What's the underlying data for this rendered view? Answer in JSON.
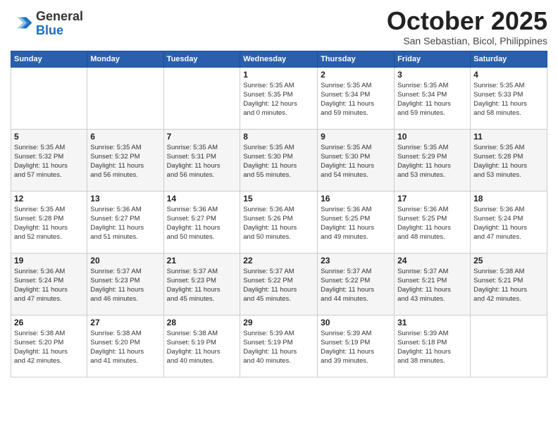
{
  "header": {
    "logo_line1": "General",
    "logo_line2": "Blue",
    "month_title": "October 2025",
    "subtitle": "San Sebastian, Bicol, Philippines"
  },
  "days_of_week": [
    "Sunday",
    "Monday",
    "Tuesday",
    "Wednesday",
    "Thursday",
    "Friday",
    "Saturday"
  ],
  "weeks": [
    [
      {
        "day": "",
        "info": ""
      },
      {
        "day": "",
        "info": ""
      },
      {
        "day": "",
        "info": ""
      },
      {
        "day": "1",
        "info": "Sunrise: 5:35 AM\nSunset: 5:35 PM\nDaylight: 12 hours\nand 0 minutes."
      },
      {
        "day": "2",
        "info": "Sunrise: 5:35 AM\nSunset: 5:34 PM\nDaylight: 11 hours\nand 59 minutes."
      },
      {
        "day": "3",
        "info": "Sunrise: 5:35 AM\nSunset: 5:34 PM\nDaylight: 11 hours\nand 59 minutes."
      },
      {
        "day": "4",
        "info": "Sunrise: 5:35 AM\nSunset: 5:33 PM\nDaylight: 11 hours\nand 58 minutes."
      }
    ],
    [
      {
        "day": "5",
        "info": "Sunrise: 5:35 AM\nSunset: 5:32 PM\nDaylight: 11 hours\nand 57 minutes."
      },
      {
        "day": "6",
        "info": "Sunrise: 5:35 AM\nSunset: 5:32 PM\nDaylight: 11 hours\nand 56 minutes."
      },
      {
        "day": "7",
        "info": "Sunrise: 5:35 AM\nSunset: 5:31 PM\nDaylight: 11 hours\nand 56 minutes."
      },
      {
        "day": "8",
        "info": "Sunrise: 5:35 AM\nSunset: 5:30 PM\nDaylight: 11 hours\nand 55 minutes."
      },
      {
        "day": "9",
        "info": "Sunrise: 5:35 AM\nSunset: 5:30 PM\nDaylight: 11 hours\nand 54 minutes."
      },
      {
        "day": "10",
        "info": "Sunrise: 5:35 AM\nSunset: 5:29 PM\nDaylight: 11 hours\nand 53 minutes."
      },
      {
        "day": "11",
        "info": "Sunrise: 5:35 AM\nSunset: 5:28 PM\nDaylight: 11 hours\nand 53 minutes."
      }
    ],
    [
      {
        "day": "12",
        "info": "Sunrise: 5:35 AM\nSunset: 5:28 PM\nDaylight: 11 hours\nand 52 minutes."
      },
      {
        "day": "13",
        "info": "Sunrise: 5:36 AM\nSunset: 5:27 PM\nDaylight: 11 hours\nand 51 minutes."
      },
      {
        "day": "14",
        "info": "Sunrise: 5:36 AM\nSunset: 5:27 PM\nDaylight: 11 hours\nand 50 minutes."
      },
      {
        "day": "15",
        "info": "Sunrise: 5:36 AM\nSunset: 5:26 PM\nDaylight: 11 hours\nand 50 minutes."
      },
      {
        "day": "16",
        "info": "Sunrise: 5:36 AM\nSunset: 5:25 PM\nDaylight: 11 hours\nand 49 minutes."
      },
      {
        "day": "17",
        "info": "Sunrise: 5:36 AM\nSunset: 5:25 PM\nDaylight: 11 hours\nand 48 minutes."
      },
      {
        "day": "18",
        "info": "Sunrise: 5:36 AM\nSunset: 5:24 PM\nDaylight: 11 hours\nand 47 minutes."
      }
    ],
    [
      {
        "day": "19",
        "info": "Sunrise: 5:36 AM\nSunset: 5:24 PM\nDaylight: 11 hours\nand 47 minutes."
      },
      {
        "day": "20",
        "info": "Sunrise: 5:37 AM\nSunset: 5:23 PM\nDaylight: 11 hours\nand 46 minutes."
      },
      {
        "day": "21",
        "info": "Sunrise: 5:37 AM\nSunset: 5:23 PM\nDaylight: 11 hours\nand 45 minutes."
      },
      {
        "day": "22",
        "info": "Sunrise: 5:37 AM\nSunset: 5:22 PM\nDaylight: 11 hours\nand 45 minutes."
      },
      {
        "day": "23",
        "info": "Sunrise: 5:37 AM\nSunset: 5:22 PM\nDaylight: 11 hours\nand 44 minutes."
      },
      {
        "day": "24",
        "info": "Sunrise: 5:37 AM\nSunset: 5:21 PM\nDaylight: 11 hours\nand 43 minutes."
      },
      {
        "day": "25",
        "info": "Sunrise: 5:38 AM\nSunset: 5:21 PM\nDaylight: 11 hours\nand 42 minutes."
      }
    ],
    [
      {
        "day": "26",
        "info": "Sunrise: 5:38 AM\nSunset: 5:20 PM\nDaylight: 11 hours\nand 42 minutes."
      },
      {
        "day": "27",
        "info": "Sunrise: 5:38 AM\nSunset: 5:20 PM\nDaylight: 11 hours\nand 41 minutes."
      },
      {
        "day": "28",
        "info": "Sunrise: 5:38 AM\nSunset: 5:19 PM\nDaylight: 11 hours\nand 40 minutes."
      },
      {
        "day": "29",
        "info": "Sunrise: 5:39 AM\nSunset: 5:19 PM\nDaylight: 11 hours\nand 40 minutes."
      },
      {
        "day": "30",
        "info": "Sunrise: 5:39 AM\nSunset: 5:19 PM\nDaylight: 11 hours\nand 39 minutes."
      },
      {
        "day": "31",
        "info": "Sunrise: 5:39 AM\nSunset: 5:18 PM\nDaylight: 11 hours\nand 38 minutes."
      },
      {
        "day": "",
        "info": ""
      }
    ]
  ]
}
